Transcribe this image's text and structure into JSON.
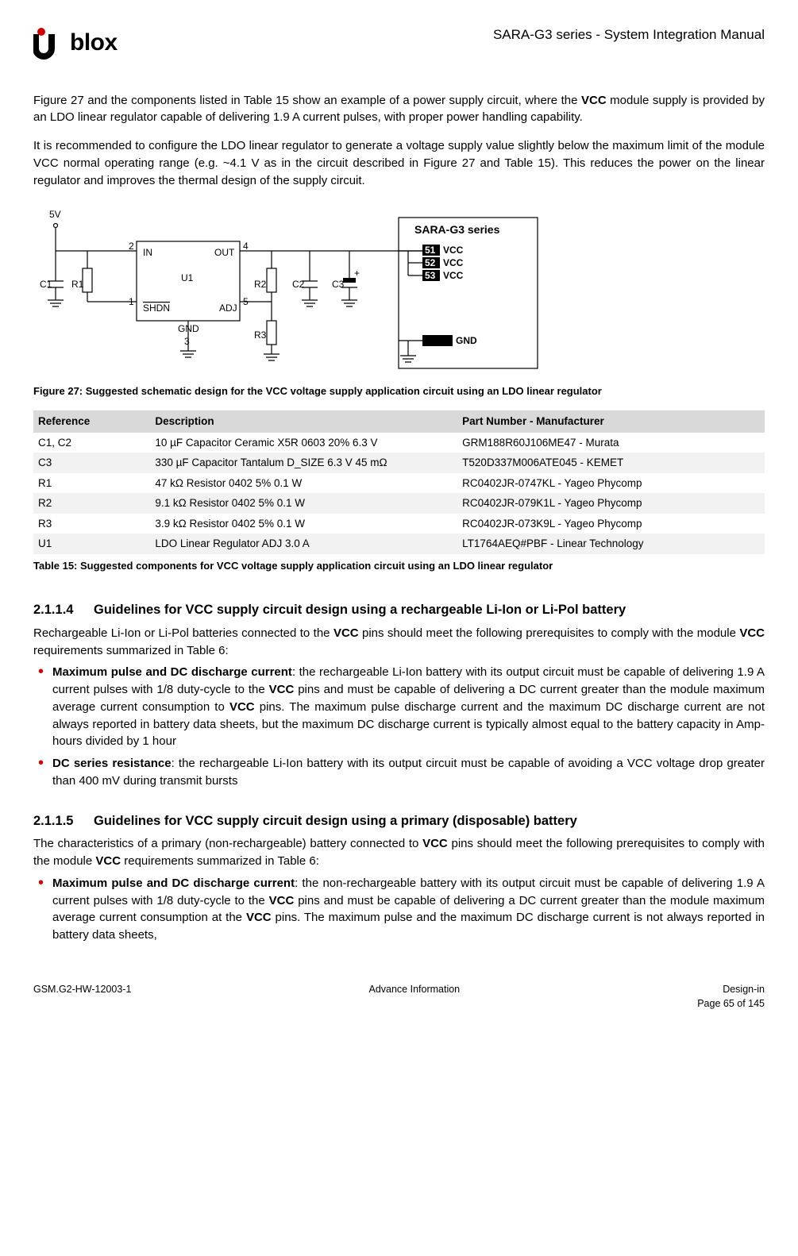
{
  "header": {
    "logo_text": "blox",
    "doc_title": "SARA-G3 series - System Integration Manual"
  },
  "intro": {
    "p1_a": "Figure 27 and the components listed in Table 15 show an example of a power supply circuit, where the ",
    "p1_b": "VCC",
    "p1_c": " module supply is provided by an LDO linear regulator capable of delivering 1.9 A current pulses, with proper power handling capability.",
    "p2": "It is recommended to configure the LDO linear regulator to generate a voltage supply value slightly below the maximum limit of the module VCC normal operating range (e.g. ~4.1 V as in the circuit described in Figure 27 and Table 15). This reduces the power on the linear regulator and improves the thermal design of the supply circuit."
  },
  "schematic": {
    "lbl_5v": "5V",
    "lbl_c1": "C1",
    "lbl_r1": "R1",
    "lbl_in": "IN",
    "lbl_out": "OUT",
    "lbl_u1": "U1",
    "lbl_shdn": "SHDN",
    "lbl_adj": "ADJ",
    "lbl_gnd_pin": "GND",
    "lbl_r2": "R2",
    "lbl_c2": "C2",
    "lbl_c3": "C3",
    "lbl_r3": "R3",
    "pin1": "1",
    "pin2": "2",
    "pin3": "3",
    "pin4": "4",
    "pin5": "5",
    "module_title": "SARA-G3 series",
    "vcc51": "51",
    "vcc52": "52",
    "vcc53": "53",
    "vcc_lbl": "VCC",
    "gnd_lbl": "GND"
  },
  "fig27_caption": "Figure 27: Suggested schematic design for the VCC voltage supply application circuit using an LDO linear regulator",
  "table": {
    "headers": {
      "ref": "Reference",
      "desc": "Description",
      "part": "Part Number - Manufacturer"
    },
    "rows": [
      {
        "ref": "C1, C2",
        "desc": "10 µF Capacitor Ceramic X5R 0603 20% 6.3 V",
        "part": "GRM188R60J106ME47 - Murata"
      },
      {
        "ref": "C3",
        "desc": "330 µF Capacitor Tantalum D_SIZE 6.3 V 45 mΩ",
        "part": "T520D337M006ATE045 - KEMET"
      },
      {
        "ref": "R1",
        "desc": "47 kΩ Resistor 0402 5% 0.1 W",
        "part": "RC0402JR-0747KL - Yageo Phycomp"
      },
      {
        "ref": "R2",
        "desc": "9.1 kΩ Resistor 0402 5% 0.1 W",
        "part": "RC0402JR-079K1L - Yageo Phycomp"
      },
      {
        "ref": "R3",
        "desc": "3.9 kΩ Resistor 0402 5% 0.1 W",
        "part": "RC0402JR-073K9L - Yageo Phycomp"
      },
      {
        "ref": "U1",
        "desc": "LDO Linear Regulator ADJ 3.0 A",
        "part": "LT1764AEQ#PBF - Linear Technology"
      }
    ]
  },
  "tbl15_caption": "Table 15: Suggested components for VCC voltage supply application circuit using an LDO linear regulator",
  "sec214": {
    "num": "2.1.1.4",
    "title": "Guidelines for VCC supply circuit design using a rechargeable Li-Ion or Li-Pol battery",
    "intro_a": "Rechargeable Li-Ion or Li-Pol batteries connected to the ",
    "intro_b": "VCC",
    "intro_c": " pins should meet the following prerequisites to comply with the module ",
    "intro_d": "VCC",
    "intro_e": " requirements summarized in Table 6:",
    "b1_a": "Maximum pulse and DC discharge current",
    "b1_b": ": the rechargeable Li-Ion battery with its output circuit must be capable of delivering 1.9 A current pulses with 1/8 duty-cycle to the ",
    "b1_c": "VCC",
    "b1_d": " pins and must be capable of delivering a DC current greater than the module maximum average current consumption to ",
    "b1_e": "VCC",
    "b1_f": " pins. The maximum pulse discharge current and the maximum DC discharge current are not always reported in battery data sheets, but the maximum DC discharge current is typically almost equal to the battery capacity in Amp-hours divided by 1 hour",
    "b2_a": "DC series resistance",
    "b2_b": ": the rechargeable Li-Ion battery with its output circuit must be capable of avoiding a VCC voltage drop greater than 400 mV during transmit bursts"
  },
  "sec215": {
    "num": "2.1.1.5",
    "title": "Guidelines for VCC supply circuit design using a primary (disposable) battery",
    "intro_a": "The characteristics of a primary (non-rechargeable) battery connected to ",
    "intro_b": "VCC",
    "intro_c": " pins should meet the following prerequisites to comply with the module ",
    "intro_d": "VCC",
    "intro_e": " requirements summarized in Table 6:",
    "b1_a": "Maximum pulse and DC discharge current",
    "b1_b": ": the non-rechargeable battery with its output circuit must be capable of delivering 1.9 A current pulses with 1/8 duty-cycle to the ",
    "b1_c": "VCC",
    "b1_d": " pins and must be capable of delivering a DC current greater than the module maximum average current consumption at the ",
    "b1_e": "VCC",
    "b1_f": " pins. The maximum pulse and the maximum DC discharge current is not always reported in battery data sheets,"
  },
  "footer": {
    "left": "GSM.G2-HW-12003-1",
    "center": "Advance Information",
    "right1": "Design-in",
    "right2": "Page 65 of 145"
  }
}
